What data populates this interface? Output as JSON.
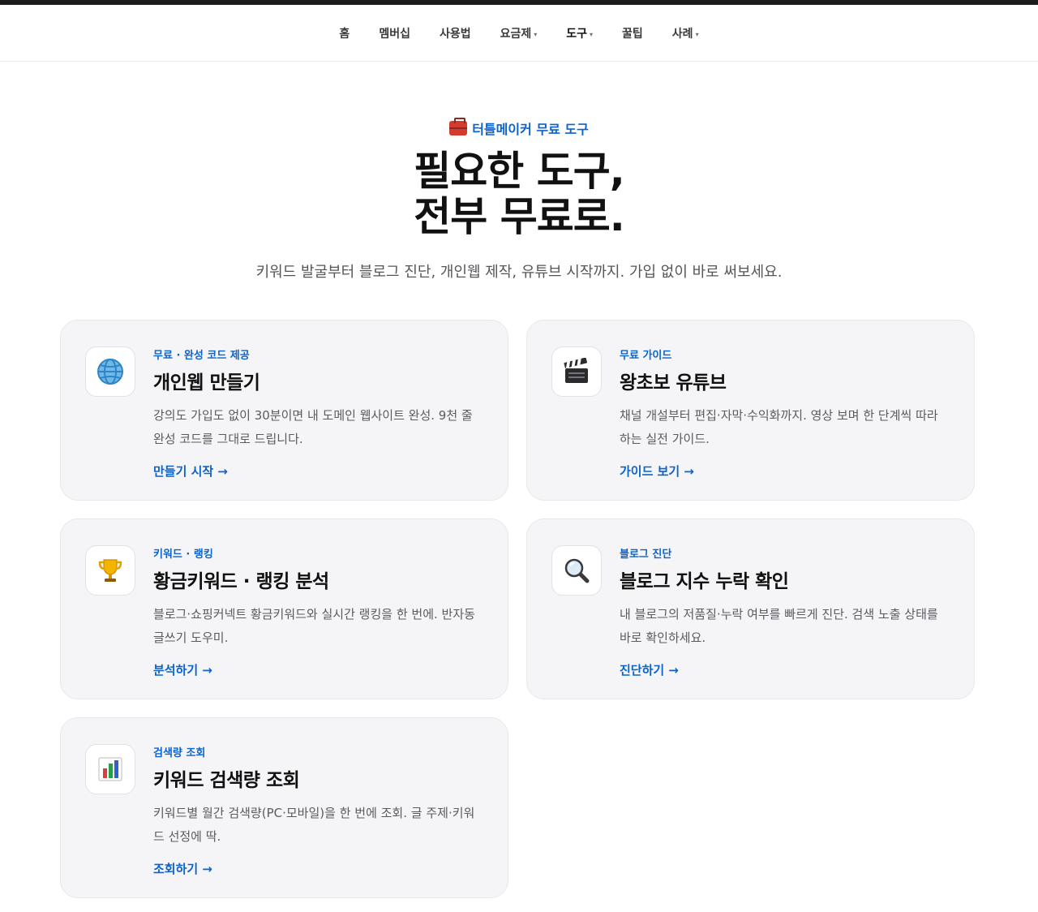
{
  "nav": {
    "items": [
      {
        "label": "홈",
        "has_caret": false,
        "active": false
      },
      {
        "label": "멤버십",
        "has_caret": false,
        "active": false
      },
      {
        "label": "사용법",
        "has_caret": false,
        "active": false
      },
      {
        "label": "요금제",
        "has_caret": true,
        "active": false
      },
      {
        "label": "도구",
        "has_caret": true,
        "active": true
      },
      {
        "label": "꿀팁",
        "has_caret": false,
        "active": false
      },
      {
        "label": "사례",
        "has_caret": true,
        "active": false
      }
    ],
    "caret": "▾"
  },
  "hero": {
    "eyebrow_icon": "toolbox-icon",
    "eyebrow": "터틀메이커 무료 도구",
    "title_line1": "필요한 도구,",
    "title_line2": "전부 무료로.",
    "subtitle": "키워드 발굴부터 블로그 진단, 개인웹 제작, 유튜브 시작까지. 가입 없이 바로 써보세요."
  },
  "cards": [
    {
      "icon": "globe-icon",
      "tag": "무료 · 완성 코드 제공",
      "title": "개인웹 만들기",
      "desc": "강의도 가입도 없이 30분이면 내 도메인 웹사이트 완성. 9천 줄 완성 코드를 그대로 드립니다.",
      "link": "만들기 시작"
    },
    {
      "icon": "clapperboard-icon",
      "tag": "무료 가이드",
      "title": "왕초보 유튜브",
      "desc": "채널 개설부터 편집·자막·수익화까지. 영상 보며 한 단계씩 따라하는 실전 가이드.",
      "link": "가이드 보기"
    },
    {
      "icon": "trophy-icon",
      "tag": "키워드 · 랭킹",
      "title": "황금키워드 · 랭킹 분석",
      "desc": "블로그·쇼핑커넥트 황금키워드와 실시간 랭킹을 한 번에. 반자동 글쓰기 도우미.",
      "link": "분석하기"
    },
    {
      "icon": "magnifier-icon",
      "tag": "블로그 진단",
      "title": "블로그 지수 누락 확인",
      "desc": "내 블로그의 저품질·누락 여부를 빠르게 진단. 검색 노출 상태를 바로 확인하세요.",
      "link": "진단하기"
    },
    {
      "icon": "bar-chart-icon",
      "tag": "검색량 조회",
      "title": "키워드 검색량 조회",
      "desc": "키워드별 월간 검색량(PC·모바일)을 한 번에 조회. 글 주제·키워드 선정에 딱.",
      "link": "조회하기"
    }
  ],
  "link_arrow": "→",
  "colors": {
    "accent": "#0b63ce",
    "card_bg": "#f5f5f7",
    "title": "#111111"
  }
}
